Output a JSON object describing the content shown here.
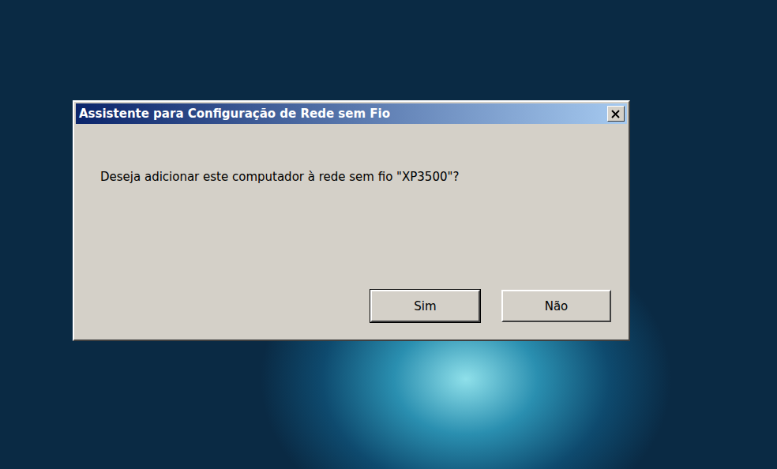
{
  "window": {
    "title": "Assistente para Configuração de Rede sem Fio"
  },
  "message": "Deseja adicionar este computador à rede sem fio \"XP3500\"?",
  "buttons": [
    {
      "label": "Sim",
      "default": true
    },
    {
      "label": "Não",
      "default": false
    }
  ]
}
